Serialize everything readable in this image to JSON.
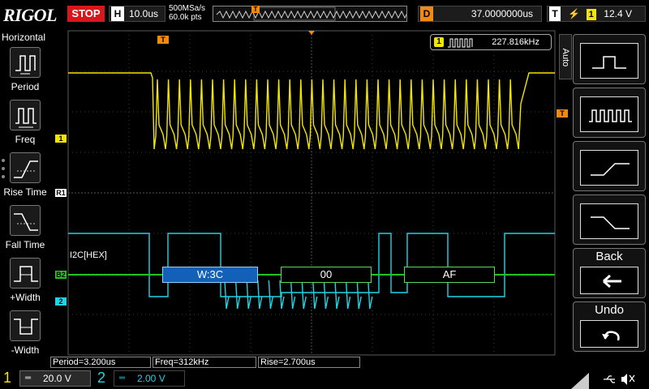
{
  "brand": {
    "logo": "RIGOL"
  },
  "topbar": {
    "run_state": "STOP",
    "horizontal_label": "H",
    "timebase": "10.0us",
    "sample_rate": "500MSa/s",
    "mem_depth": "60.0k pts",
    "delay_label": "D",
    "delay": "37.0000000us",
    "trigger_label": "T",
    "trigger_source": "1",
    "trigger_level": "12.4 V"
  },
  "left_menu": {
    "title": "Horizontal",
    "items": [
      {
        "label": "Period",
        "icon": "period-icon"
      },
      {
        "label": "Freq",
        "icon": "freq-icon"
      },
      {
        "label": "Rise Time",
        "icon": "rise-time-icon"
      },
      {
        "label": "Fall Time",
        "icon": "fall-time-icon"
      },
      {
        "label": "+Width",
        "icon": "pos-width-icon"
      },
      {
        "label": "-Width",
        "icon": "neg-width-icon"
      }
    ]
  },
  "measure_readout": {
    "channel": "1",
    "value": "227.816kHz"
  },
  "decode": {
    "label": "I2C[HEX]",
    "frames": [
      {
        "text": "W:3C",
        "kind": "address"
      },
      {
        "text": "00",
        "kind": "data"
      },
      {
        "text": "AF",
        "kind": "data"
      }
    ]
  },
  "markers": {
    "ch1": "1",
    "ch2": "2",
    "r1": "R1",
    "b2": "B2",
    "trig_top": "T",
    "trig_right": "T"
  },
  "right_menu": {
    "mode": "Auto",
    "back_label": "Back",
    "undo_label": "Undo"
  },
  "measurements": [
    {
      "text": "Period=3.200us"
    },
    {
      "text": "Freq=312kHz"
    },
    {
      "text": "Rise=2.700us"
    }
  ],
  "channels": [
    {
      "number": "1",
      "scale": "20.0 V",
      "color": "#f2e600"
    },
    {
      "number": "2",
      "scale": "2.00 V",
      "color": "#1fd4e6"
    }
  ],
  "colors": {
    "ch1": "#f2e600",
    "ch2": "#1fd4e6",
    "decode_bus": "#22c322",
    "address_fill": "#1260b8",
    "trigger": "#f08a10"
  }
}
